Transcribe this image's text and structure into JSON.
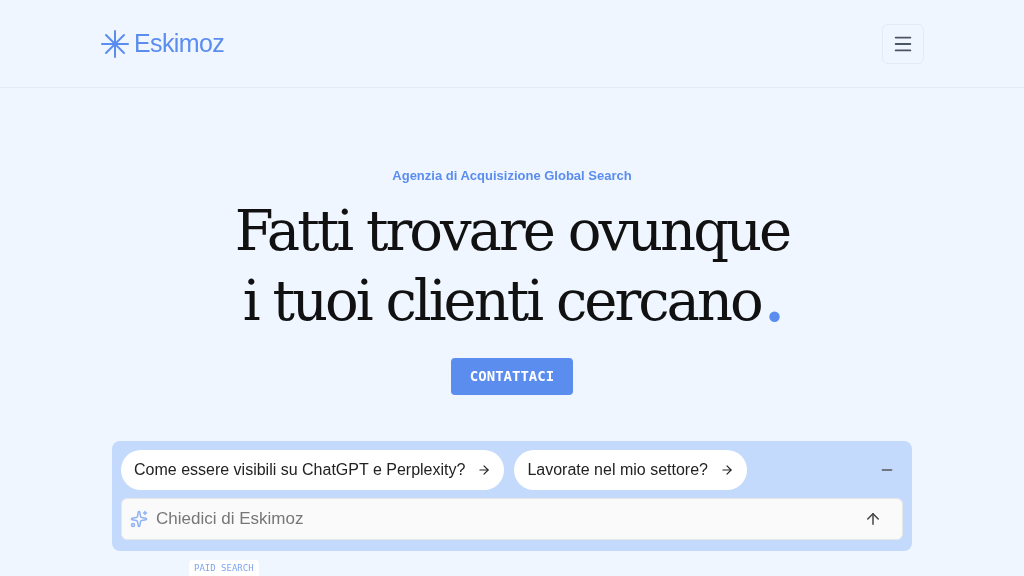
{
  "header": {
    "logo": "Eskimoz"
  },
  "hero": {
    "eyebrow": "Agenzia di Acquisizione Global Search",
    "headline": [
      "Fatti trovare ovunque",
      "i tuoi clienti cercano"
    ],
    "accent": ".",
    "cta": "CONTATTACI"
  },
  "chat": {
    "suggestions": [
      "Come essere visibili su ChatGPT e Perplexity?",
      "Lavorate nel mio settore?"
    ],
    "placeholder": "Chiedici di Eskimoz"
  },
  "badge": "PAID SEARCH"
}
